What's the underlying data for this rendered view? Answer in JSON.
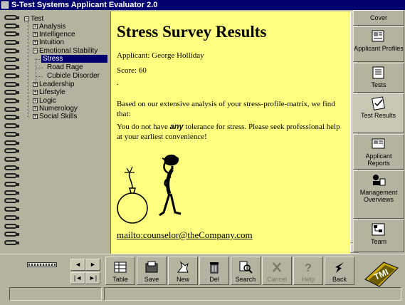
{
  "window": {
    "title": "S-Test Systems Applicant Evaluator 2.0"
  },
  "tree": {
    "root": "Test",
    "items": [
      "Analysis",
      "Intelligence",
      "Intuition",
      "Emotional Stability",
      "Stress",
      "Road Rage",
      "Cubicle Disorder",
      "Leadership",
      "Lifestyle",
      "Logic",
      "Numerology",
      "Social Skills"
    ],
    "selected": "Stress"
  },
  "content": {
    "heading": "Stress Survey Results",
    "applicant": "Applicant: George Holliday",
    "score": "Score: 60",
    "dot": ".",
    "para1": "Based on our extensive analysis of your stress-profile-matrix, we find that:",
    "para2_a": "You do not have ",
    "para2_em": "any",
    "para2_b": " tolerance for stress. Please seek professional help at your earliest convenience!",
    "mailto": "mailto:counselor@theCompany.com"
  },
  "tabs": [
    {
      "label": "Cover",
      "icon": "cover-icon"
    },
    {
      "label": "Applicant Profiles",
      "icon": "profiles-icon"
    },
    {
      "label": "Tests",
      "icon": "tests-icon"
    },
    {
      "label": "Test Results",
      "icon": "test-results-icon",
      "active": true
    },
    {
      "label": "Applicant Reports",
      "icon": "reports-icon"
    },
    {
      "label": "Management Overviews",
      "icon": "overviews-icon"
    },
    {
      "label": "Team",
      "icon": "team-icon"
    }
  ],
  "toolbar": {
    "nav": {
      "prev": "◄",
      "next": "►",
      "first": "|◄",
      "last": "►|"
    },
    "buttons": [
      {
        "label": "Table",
        "icon": "table-icon"
      },
      {
        "label": "Save",
        "icon": "save-icon"
      },
      {
        "label": "New",
        "icon": "new-icon"
      },
      {
        "label": "Del",
        "icon": "delete-icon"
      },
      {
        "label": "Search",
        "icon": "search-icon"
      },
      {
        "label": "Cancel",
        "icon": "cancel-icon",
        "disabled": true
      },
      {
        "label": "Help",
        "icon": "help-icon",
        "disabled": true
      },
      {
        "label": "Back",
        "icon": "back-icon"
      }
    ]
  },
  "logo": {
    "text": "TMI",
    "icon": "company-logo"
  },
  "colors": {
    "titlebar": "#000070",
    "content_bg": "#ffff80",
    "selection": "#000070",
    "chrome": "#b3b39f"
  }
}
